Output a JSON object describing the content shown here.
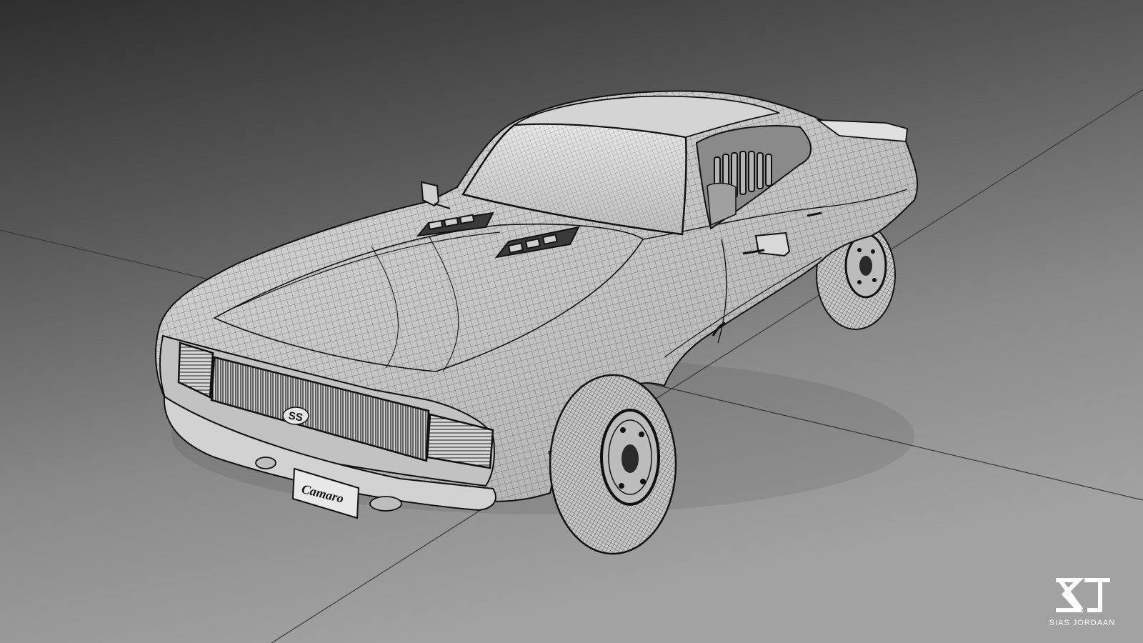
{
  "scene": {
    "subject": "car-wireframe-render",
    "background_gradient": [
      "#2e2e2e",
      "#5a5a5a",
      "#8a8a8a",
      "#a2a2a2"
    ],
    "body_color": "#c9c9c9",
    "wire_color": "#1a1a1a",
    "ground_axis_color": "#3a3a3a",
    "front_badge": "SS",
    "license_plate": "Camaro"
  },
  "watermark": {
    "text": "SIAS JORDAAN",
    "logo_icon": "sj-monogram-icon",
    "color": "#ffffff"
  }
}
